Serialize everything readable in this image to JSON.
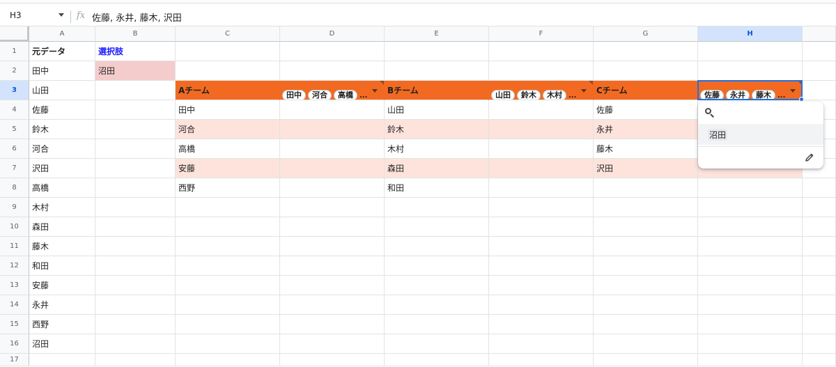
{
  "formula_bar": {
    "name_box": "H3",
    "fx_label": "fx",
    "formula": "佐藤, 永井, 藤木, 沢田"
  },
  "columns": [
    "A",
    "B",
    "C",
    "D",
    "E",
    "F",
    "G",
    "H"
  ],
  "selected_column": "H",
  "rows": [
    "1",
    "2",
    "3",
    "4",
    "5",
    "6",
    "7",
    "8",
    "9",
    "10",
    "11",
    "12",
    "13",
    "14",
    "15",
    "16",
    "17"
  ],
  "selected_row": "3",
  "col_a": {
    "header": "元データ",
    "names": [
      "田中",
      "山田",
      "佐藤",
      "鈴木",
      "河合",
      "沢田",
      "高橋",
      "木村",
      "森田",
      "藤木",
      "和田",
      "安藤",
      "永井",
      "西野",
      "沼田"
    ]
  },
  "col_b": {
    "header": "選択肢",
    "value": "沼田"
  },
  "teams": [
    {
      "name": "Aチーム",
      "chips": [
        "田中",
        "河合",
        "高橋"
      ],
      "members": [
        "田中",
        "河合",
        "高橋",
        "安藤",
        "西野"
      ]
    },
    {
      "name": "Bチーム",
      "chips": [
        "山田",
        "鈴木",
        "木村"
      ],
      "members": [
        "山田",
        "鈴木",
        "木村",
        "森田",
        "和田"
      ]
    },
    {
      "name": "Cチーム",
      "chips": [
        "佐藤",
        "永井",
        "藤木"
      ],
      "members": [
        "佐藤",
        "永井",
        "藤木",
        "沢田"
      ]
    }
  ],
  "chip_more": "...",
  "dropdown": {
    "option": "沼田",
    "search_icon": "search-icon",
    "edit_icon": "pencil-icon"
  },
  "colors": {
    "header_orange": "#f26a21",
    "band_pink": "#fde3dc",
    "choice_pink": "#f4cccc",
    "selection_blue": "#1a73e8",
    "label_blue": "#1a1aff"
  }
}
